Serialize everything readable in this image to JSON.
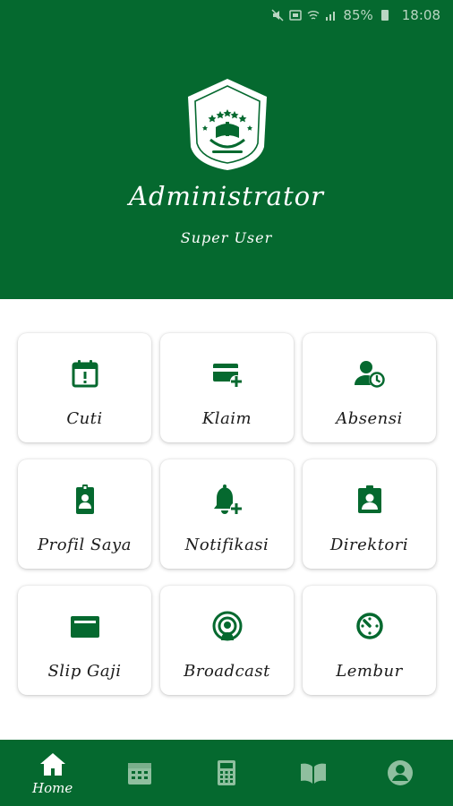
{
  "status_bar": {
    "battery": "85%",
    "time": "18:08"
  },
  "profile": {
    "name": "Administrator",
    "role": "Super User"
  },
  "menu": [
    {
      "label": "Cuti",
      "icon": "calendar-alert-icon"
    },
    {
      "label": "Klaim",
      "icon": "card-add-icon"
    },
    {
      "label": "Absensi",
      "icon": "user-clock-icon"
    },
    {
      "label": "Profil Saya",
      "icon": "id-badge-icon"
    },
    {
      "label": "Notifikasi",
      "icon": "bell-add-icon"
    },
    {
      "label": "Direktori",
      "icon": "contact-card-icon"
    },
    {
      "label": "Slip Gaji",
      "icon": "payment-card-icon"
    },
    {
      "label": "Broadcast",
      "icon": "broadcast-icon"
    },
    {
      "label": "Lembur",
      "icon": "timer-icon"
    }
  ],
  "bottom_nav": [
    {
      "label": "Home",
      "icon": "home-icon",
      "active": true
    },
    {
      "icon": "calendar-icon"
    },
    {
      "icon": "calculator-icon"
    },
    {
      "icon": "book-icon"
    },
    {
      "icon": "account-icon"
    }
  ],
  "colors": {
    "primary": "#05692f",
    "icon": "#05692f",
    "nav_inactive": "#8fbf9f"
  }
}
